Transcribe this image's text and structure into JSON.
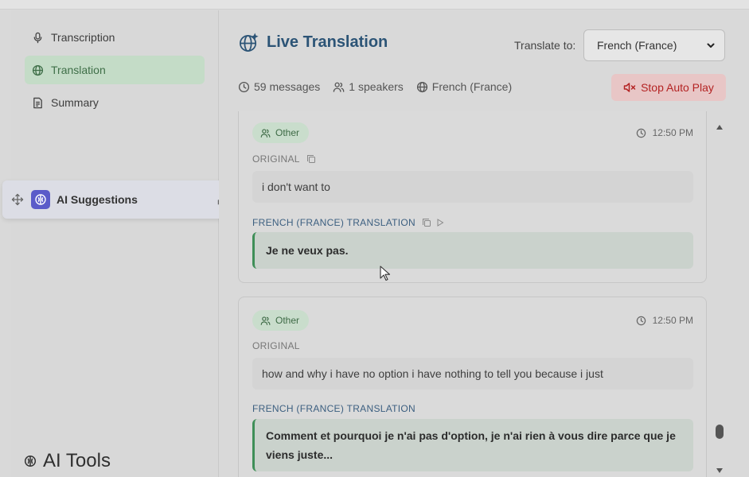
{
  "sidebar": {
    "items": [
      {
        "label": "Transcription",
        "icon": "microphone-icon"
      },
      {
        "label": "Translation",
        "icon": "globe-icon",
        "active": true
      },
      {
        "label": "Summary",
        "icon": "document-icon"
      }
    ],
    "ai_suggestions": {
      "label": "AI Suggestions"
    },
    "ai_tools_label": "AI Tools"
  },
  "header": {
    "title": "Live Translation",
    "translate_to_label": "Translate to:",
    "language_selected": "French (France)",
    "stats": {
      "messages": "59 messages",
      "speakers": "1 speakers",
      "language": "French (France)"
    },
    "stop_button": "Stop Auto Play"
  },
  "messages": [
    {
      "speaker": "Other",
      "time": "12:50 PM",
      "original_label": "ORIGINAL",
      "original_text": "i don't want to",
      "translation_label": "FRENCH (FRANCE) TRANSLATION",
      "translation_text": "Je ne veux pas."
    },
    {
      "speaker": "Other",
      "time": "12:50 PM",
      "original_label": "ORIGINAL",
      "original_text": "how and why i have no option i have nothing to tell you because i just",
      "translation_label": "FRENCH (FRANCE) TRANSLATION",
      "translation_line1": "Comment et pourquoi je n'ai pas d'option, je n'ai rien à vous dire parce que je",
      "translation_line2": "viens juste..."
    }
  ],
  "colors": {
    "accent_blue": "#2c5476",
    "active_green": "#3f6f48",
    "stop_red": "#b42323",
    "translation_bar": "#3f8f58"
  }
}
